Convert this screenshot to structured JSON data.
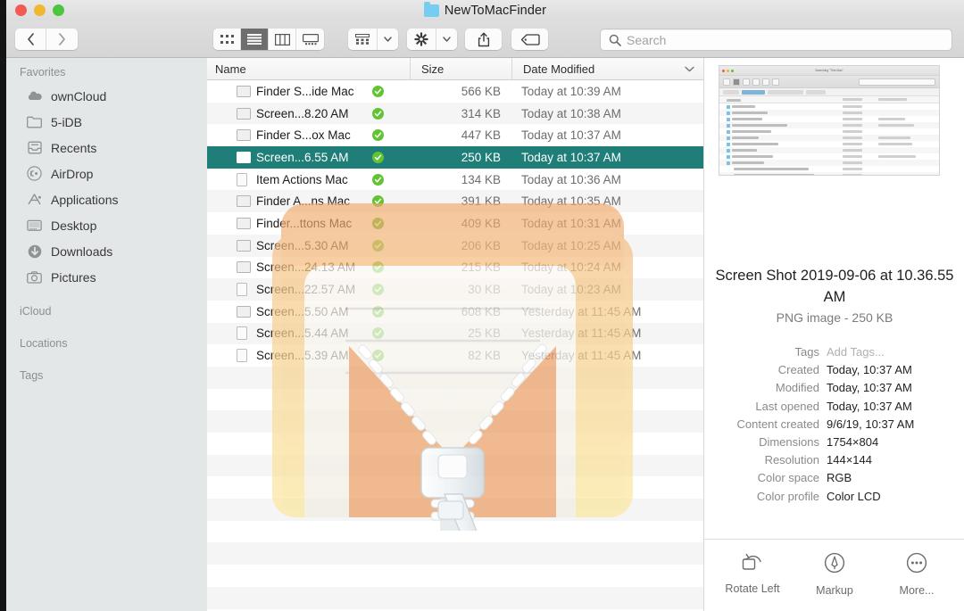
{
  "window": {
    "title": "NewToMacFinder",
    "title_icon": "blue-folder-icon",
    "traffic_lights": [
      "close-button",
      "minimize-button",
      "maximize-button"
    ]
  },
  "toolbar": {
    "back_label": "‹",
    "forward_label": "›",
    "view_buttons": [
      {
        "name": "icon-view",
        "active": false
      },
      {
        "name": "list-view",
        "active": true
      },
      {
        "name": "column-view",
        "active": false
      },
      {
        "name": "gallery-view",
        "active": false
      }
    ],
    "arrange_label": "arrange-icon",
    "action_label": "gear-icon",
    "share_label": "share-icon",
    "tag_label": "tag-icon",
    "search": {
      "placeholder": "Search",
      "value": ""
    }
  },
  "sidebar": {
    "sections": [
      {
        "title": "Favorites",
        "items": [
          {
            "label": "ownCloud",
            "icon": "cloud-icon"
          },
          {
            "label": "5-iDB",
            "icon": "folder-icon"
          },
          {
            "label": "Recents",
            "icon": "clock-drawer-icon"
          },
          {
            "label": "AirDrop",
            "icon": "airdrop-icon"
          },
          {
            "label": "Applications",
            "icon": "applications-icon"
          },
          {
            "label": "Desktop",
            "icon": "desktop-icon"
          },
          {
            "label": "Downloads",
            "icon": "downloads-icon"
          },
          {
            "label": "Pictures",
            "icon": "pictures-icon"
          }
        ]
      },
      {
        "title": "iCloud",
        "items": []
      },
      {
        "title": "Locations",
        "items": []
      },
      {
        "title": "Tags",
        "items": []
      }
    ]
  },
  "filelist": {
    "columns": [
      {
        "key": "name",
        "label": "Name"
      },
      {
        "key": "size",
        "label": "Size"
      },
      {
        "key": "date",
        "label": "Date Modified"
      }
    ],
    "sort_indicator": "chevron-down-icon",
    "rows": [
      {
        "name": "Finder S...ide Mac",
        "size": "566 KB",
        "date": "Today at 10:39 AM",
        "icon": "image-file-icon",
        "badge": "green-check-badge",
        "selected": false
      },
      {
        "name": "Screen...8.20 AM",
        "size": "314 KB",
        "date": "Today at 10:38 AM",
        "icon": "image-file-icon",
        "badge": "green-check-badge",
        "selected": false
      },
      {
        "name": "Finder S...ox Mac",
        "size": "447 KB",
        "date": "Today at 10:37 AM",
        "icon": "image-file-icon",
        "badge": "green-check-badge",
        "selected": false
      },
      {
        "name": "Screen...6.55 AM",
        "size": "250 KB",
        "date": "Today at 10:37 AM",
        "icon": "image-file-icon",
        "badge": "green-check-badge",
        "selected": true
      },
      {
        "name": "Item Actions Mac",
        "size": "134 KB",
        "date": "Today at 10:36 AM",
        "icon": "doc-file-icon",
        "badge": "green-check-badge",
        "selected": false
      },
      {
        "name": "Finder A...ns Mac",
        "size": "391 KB",
        "date": "Today at 10:35 AM",
        "icon": "image-file-icon",
        "badge": "green-check-badge",
        "selected": false
      },
      {
        "name": "Finder...ttons Mac",
        "size": "409 KB",
        "date": "Today at 10:31 AM",
        "icon": "image-file-icon",
        "badge": "green-check-badge",
        "selected": false
      },
      {
        "name": "Screen...5.30 AM",
        "size": "206 KB",
        "date": "Today at 10:25 AM",
        "icon": "image-file-icon",
        "badge": "green-check-badge",
        "selected": false
      },
      {
        "name": "Screen...24.13 AM",
        "size": "215 KB",
        "date": "Today at 10:24 AM",
        "icon": "image-file-icon",
        "badge": "green-check-badge",
        "selected": false
      },
      {
        "name": "Screen...22.57 AM",
        "size": "30 KB",
        "date": "Today at 10:23 AM",
        "icon": "doc-file-icon",
        "badge": "green-check-badge",
        "selected": false
      },
      {
        "name": "Screen...5.50 AM",
        "size": "608 KB",
        "date": "Yesterday at 11:45 AM",
        "icon": "image-file-icon",
        "badge": "green-check-badge",
        "selected": false
      },
      {
        "name": "Screen...5.44 AM",
        "size": "25 KB",
        "date": "Yesterday at 11:45 AM",
        "icon": "doc-file-icon",
        "badge": "green-check-badge",
        "selected": false
      },
      {
        "name": "Screen...5.39 AM",
        "size": "82 KB",
        "date": "Yesterday at 11:45 AM",
        "icon": "doc-file-icon",
        "badge": "green-check-badge",
        "selected": false
      }
    ]
  },
  "preview": {
    "thumbnail_name": "finder-window-screenshot-thumbnail",
    "title": "Screen Shot 2019-09-06 at 10.36.55 AM",
    "subtitle": "PNG image - 250 KB",
    "metadata": [
      {
        "label": "Tags",
        "value": "Add Tags...",
        "placeholder": true
      },
      {
        "label": "Created",
        "value": "Today, 10:37 AM",
        "placeholder": false
      },
      {
        "label": "Modified",
        "value": "Today, 10:37 AM",
        "placeholder": false
      },
      {
        "label": "Last opened",
        "value": "Today, 10:37 AM",
        "placeholder": false
      },
      {
        "label": "Content created",
        "value": "9/6/19, 10:37 AM",
        "placeholder": false
      },
      {
        "label": "Dimensions",
        "value": "1754×804",
        "placeholder": false
      },
      {
        "label": "Resolution",
        "value": "144×144",
        "placeholder": false
      },
      {
        "label": "Color space",
        "value": "RGB",
        "placeholder": false
      },
      {
        "label": "Color profile",
        "value": "Color LCD",
        "placeholder": false
      }
    ],
    "actions": [
      {
        "label": "Rotate Left",
        "icon": "rotate-left-icon"
      },
      {
        "label": "Markup",
        "icon": "markup-icon"
      },
      {
        "label": "More...",
        "icon": "more-icon"
      }
    ]
  },
  "colors": {
    "selection": "#1f7f78",
    "badge_green": "#63c333",
    "titlebar": "#e2e2e2",
    "sidebar": "#e4e7e7",
    "row_alt": "#f5f5f5",
    "folder_blue": "#76cdf2"
  }
}
